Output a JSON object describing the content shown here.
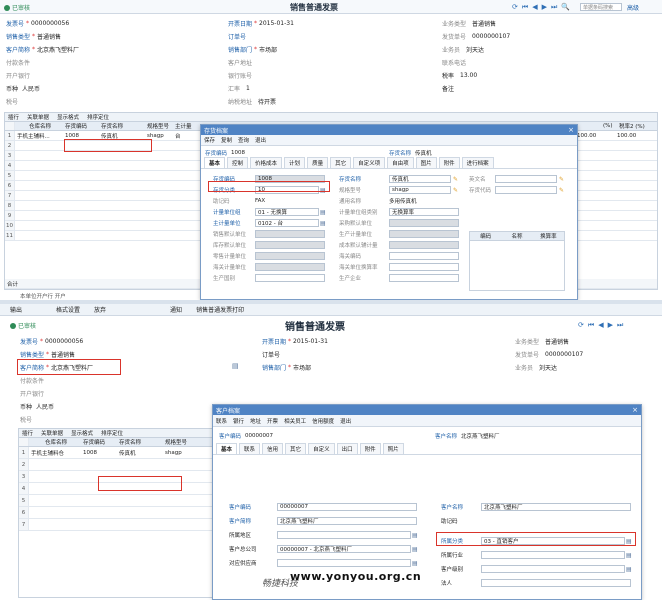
{
  "top": {
    "status": "已审核",
    "title": "销售普通发票",
    "search_placeholder": "单据条码搜索",
    "search_label": "高级",
    "header": {
      "invoice_no_label": "发票号",
      "invoice_no": "0000000056",
      "date_label": "开票日期",
      "date": "2015-01-31",
      "biz_type_label": "业务类型",
      "biz_type": "普通销售",
      "sale_type_label": "销售类型",
      "sale_type": "普通销售",
      "order_label": "订单号",
      "dispatch_label": "发货单号",
      "dispatch": "0000000107",
      "customer_label": "客户简称",
      "customer": "北京燕飞塑料厂",
      "dept_label": "销售部门",
      "dept": "市场部",
      "staff_label": "业务员",
      "staff": "刘天达",
      "pay_label": "付款条件",
      "addr_label": "客户地址",
      "phone_label": "联系电话",
      "bank_label": "开户银行",
      "account_label": "银行账号",
      "rate_label": "税率",
      "rate": "13.00",
      "currency_label": "币种",
      "currency": "人民币",
      "exrate_label": "汇率",
      "exrate": "1",
      "remark_label": "备注",
      "taxno_label": "税号",
      "tax_addr_label": "纳税地址",
      "tax_addr": "待开票"
    },
    "grid_tabs": [
      "插行",
      "关联单据",
      "显示格式",
      "排序定位"
    ],
    "grid_cols": [
      "仓库名称",
      "存货编码",
      "存货名称",
      "规格型号",
      "主计量"
    ],
    "row1": {
      "warehouse": "手机主辅料...",
      "code": "1008",
      "name": "传真机",
      "spec": "shagp",
      "unit": "台"
    },
    "right_cols": [
      "(%)",
      "税率2 (%)"
    ],
    "right_vals": [
      "100.00",
      "100.00"
    ],
    "rows": [
      "1",
      "2",
      "3",
      "4",
      "5",
      "6",
      "7",
      "8",
      "9",
      "10",
      "11"
    ],
    "total_label": "合计",
    "bottom_label": "本单位开户行 开户"
  },
  "dlg1": {
    "title": "存货档案",
    "toolbar": [
      "保存",
      "复制",
      "查询",
      "退出"
    ],
    "code_label": "存货编码",
    "code": "1008",
    "name_label": "存货名称",
    "name": "传真机",
    "tabs": [
      "基本",
      "控制",
      "价格成本",
      "计划",
      "质量",
      "其它",
      "自定义项",
      "自由项",
      "图片",
      "附件",
      "进行档案"
    ],
    "f": {
      "code_label": "存货编码",
      "code": "1008",
      "name_label": "存货名称",
      "name": "传真机",
      "en_label": "英文名",
      "class_label": "存货分类",
      "class": "10",
      "spec_label": "规格型号",
      "spec": "shagp",
      "ccode_label": "存货代码",
      "short_label": "助记码",
      "short": "FAX",
      "common_label": "通用名称",
      "common": "多用传真机",
      "unitgroup_label": "计量单位组",
      "unitgroup": "01 - 无换算",
      "unitgroup_type_label": "计量单位组类别",
      "unitgroup_type": "无换算率",
      "mainunit_label": "主计量单位",
      "mainunit": "0102 - 台",
      "buyunit_label": "采购默认单位",
      "saleunit_label": "销售默认单位",
      "produnit_label": "生产计量单位",
      "stockunit_label": "库存默认单位",
      "costunit_label": "成本默认辅计量",
      "retailunit_label": "零售计量单位",
      "customsunit_label": "海关编码",
      "customs2_label": "海关计量单位",
      "customs3_label": "海关单位换算率",
      "factory_label": "生产国别",
      "company_label": "生产企业"
    },
    "table_cols": [
      "编码",
      "名称",
      "换算率"
    ]
  },
  "bottom": {
    "toolbar": [
      "输出",
      "格式设置",
      "放弃"
    ],
    "toolbar2": [
      "通知",
      "销售普通发票打印"
    ],
    "status": "已审核",
    "title": "销售普通发票",
    "header": {
      "invoice_no_label": "发票号",
      "invoice_no": "0000000056",
      "date_label": "开票日期",
      "date": "2015-01-31",
      "biz_type_label": "业务类型",
      "biz_type": "普通销售",
      "sale_type_label": "销售类型",
      "sale_type": "普通销售",
      "order_label": "订单号",
      "dispatch_label": "发货单号",
      "dispatch": "0000000107",
      "customer_label": "客户简称",
      "customer": "北京燕飞塑料厂",
      "dept_label": "销售部门",
      "dept": "市场部",
      "staff_label": "业务员",
      "staff": "刘天达",
      "pay_label": "付款条件",
      "bank_label": "开户银行",
      "currency_label": "币种",
      "currency": "人民币",
      "taxno_label": "税号"
    },
    "grid_tabs": [
      "插行",
      "关联单据",
      "显示格式",
      "排序定位"
    ],
    "grid_cols": [
      "仓库名称",
      "存货编码",
      "存货名称",
      "规格型号"
    ],
    "row1": {
      "warehouse": "手机主辅料仓",
      "code": "1008",
      "name": "传真机",
      "spec": "shagp"
    },
    "rows": [
      "1",
      "2",
      "3",
      "4",
      "5",
      "6",
      "7"
    ]
  },
  "dlg2": {
    "title": "客户档案",
    "toolbar": [
      "联系",
      "银行",
      "地址",
      "开票",
      "相关员工",
      "信用额度",
      "退出"
    ],
    "code_label": "客户编码",
    "code": "00000007",
    "name_label": "客户名称",
    "name": "北京燕飞塑料厂",
    "tabs": [
      "基本",
      "联系",
      "信用",
      "其它",
      "自定义",
      "出口",
      "附件",
      "照片"
    ],
    "f": {
      "code_label": "客户编码",
      "code": "00000007",
      "name_label": "客户名称",
      "name": "北京燕飞塑料厂",
      "short_label": "客户简称",
      "short": "北京燕飞塑料厂",
      "mnemonic_label": "助记码",
      "region_label": "所属地区",
      "class_label": "所属分类",
      "class": "03 - 直销客户",
      "parent_label": "客户总公司",
      "parent": "00000007 - 北京燕飞塑料厂",
      "industry_label": "所属行业",
      "currency_label": "对应供应商",
      "level_label": "客户级别",
      "legal_label": "法人"
    }
  },
  "watermark": {
    "cn": "畅捷科技",
    "url": "www.yonyou.org.cn"
  }
}
